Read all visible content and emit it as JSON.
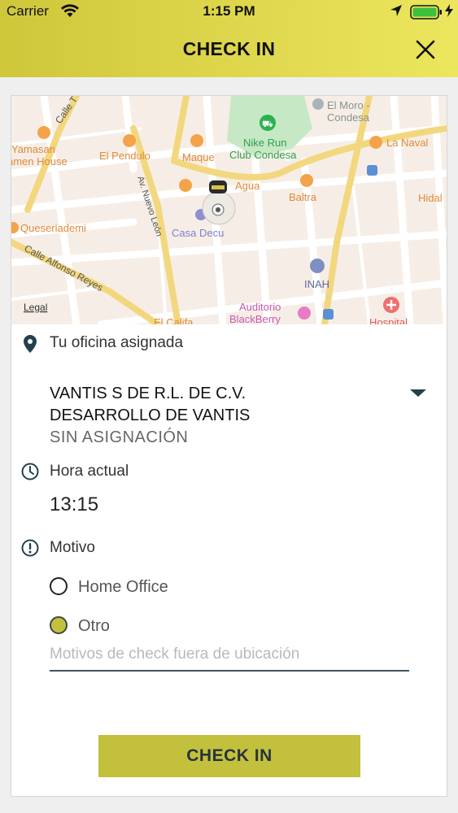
{
  "status_bar": {
    "carrier": "Carrier",
    "time": "1:15 PM"
  },
  "header": {
    "title": "CHECK IN",
    "close_icon": "close-icon"
  },
  "map": {
    "labels": {
      "el_moro_1": "El Moro -",
      "el_moro_2": "Condesa",
      "nike_1": "Nike Run",
      "nike_2": "Club Condesa",
      "calle_t": "Calle T",
      "yamasan_1": "Yamasan",
      "yamasan_2": "amen House",
      "el_pendulo": "El Pendulo",
      "maque": "Maque",
      "la_naval": "La Naval",
      "agua": "Agua",
      "baltra": "Baltra",
      "hidal": "Hidal",
      "nuevo_leon": "Av. Nuevo León",
      "queseriademi": "Queseriademi",
      "casa_decu": "Casa Decu",
      "alfonso_reyes": "Calle Alfonso Reyes",
      "inah": "INAH",
      "legal": "Legal",
      "auditorio_1": "Auditorio",
      "auditorio_2": "BlackBerry",
      "hospital": "Hospital",
      "el_califa": "El Califa"
    }
  },
  "office": {
    "label": "Tu oficina asignada",
    "name": "VANTIS S DE R.L. DE C.V.",
    "department": "DESARROLLO DE VANTIS",
    "status": "SIN ASIGNACIÓN"
  },
  "hora": {
    "label": "Hora actual",
    "value": "13:15"
  },
  "motivo": {
    "label": "Motivo",
    "options": [
      {
        "label": "Home Office",
        "selected": false
      },
      {
        "label": "Otro",
        "selected": true
      }
    ],
    "input_placeholder": "Motivos de check fuera de ubicación",
    "input_value": ""
  },
  "checkin_button": {
    "label": "CHECK IN"
  },
  "colors": {
    "header_start": "#cfc73a",
    "header_end": "#ece65e",
    "accent": "#c3c03e",
    "icon": "#24404c"
  }
}
